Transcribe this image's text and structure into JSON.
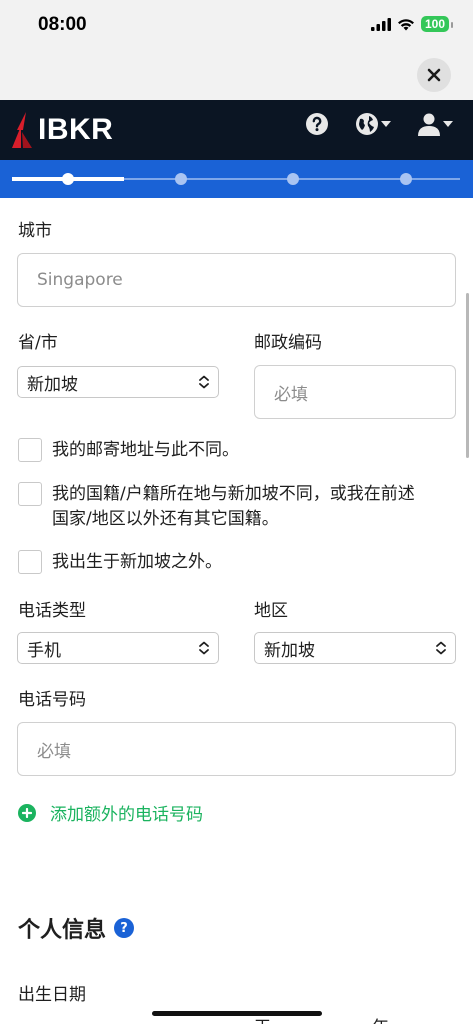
{
  "status_bar": {
    "time": "08:00",
    "battery": "100"
  },
  "header": {
    "logo_text": "IBKR"
  },
  "progress": {
    "steps": 4,
    "current_step": 1
  },
  "form": {
    "city": {
      "label": "城市",
      "placeholder": "Singapore"
    },
    "province": {
      "label": "省/市",
      "value": "新加坡"
    },
    "postal_code": {
      "label": "邮政编码",
      "placeholder": "必填"
    },
    "checkboxes": [
      {
        "label": "我的邮寄地址与此不同。",
        "checked": false
      },
      {
        "label_line1": "我的国籍/户籍所在地与新加坡不同，或我在前述",
        "label_line2": "国家/地区以外还有其它国籍。",
        "checked": false
      },
      {
        "label": "我出生于新加坡之外。",
        "checked": false
      }
    ],
    "phone_type": {
      "label": "电话类型",
      "value": "手机"
    },
    "region": {
      "label": "地区",
      "value": "新加坡"
    },
    "phone_number": {
      "label": "电话号码",
      "placeholder": "必填"
    },
    "add_phone_label": "添加额外的电话号码"
  },
  "personal_info": {
    "title": "个人信息",
    "help_icon": "?",
    "birth_date_label": "出生日期",
    "partial_labels": [
      "天",
      "年"
    ]
  },
  "icons": [
    "close-icon",
    "help-icon",
    "globe-icon",
    "user-icon",
    "chevron-updown-icon",
    "plus-circle-icon"
  ],
  "colors": {
    "header_bg": "#0b1523",
    "progress_bg": "#1a62d6",
    "accent_green": "#1bb35f",
    "logo_red": "#d81e2b"
  }
}
